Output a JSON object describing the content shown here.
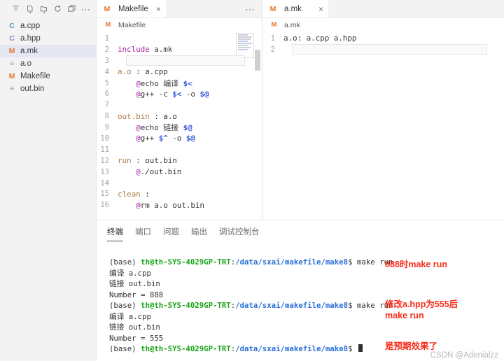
{
  "sidebar": {
    "toolbar": [
      {
        "name": "new-file-icon",
        "label": "New File"
      },
      {
        "name": "new-folder-icon",
        "label": "New Folder"
      },
      {
        "name": "refresh-icon",
        "label": "Refresh Explorer"
      },
      {
        "name": "collapse-folders-icon",
        "label": "Collapse Folders"
      },
      {
        "name": "more-actions-icon",
        "label": "···"
      }
    ],
    "files": [
      {
        "name": "a.cpp",
        "icon": "cpp-file-icon",
        "glyph": "C",
        "selected": false
      },
      {
        "name": "a.hpp",
        "icon": "hpp-file-icon",
        "glyph": "C",
        "selected": false
      },
      {
        "name": "a.mk",
        "icon": "makefile-icon",
        "glyph": "M",
        "selected": true
      },
      {
        "name": "a.o",
        "icon": "binary-file-icon",
        "glyph": "≡",
        "selected": false
      },
      {
        "name": "Makefile",
        "icon": "makefile-icon",
        "glyph": "M",
        "selected": false
      },
      {
        "name": "out.bin",
        "icon": "binary-file-icon",
        "glyph": "≡",
        "selected": false
      }
    ]
  },
  "editors": [
    {
      "tab_label": "Makefile",
      "tab_icon_glyph": "M",
      "tab_close": "×",
      "tab_actions": "···",
      "breadcrumb": "Makefile",
      "lines": [
        {
          "n": "1",
          "tokens": []
        },
        {
          "n": "2",
          "tokens": [
            {
              "t": "include",
              "c": "tk-include"
            },
            {
              "t": " a.mk",
              "c": "tk-plain"
            }
          ]
        },
        {
          "n": "3",
          "tokens": [],
          "cursor": true
        },
        {
          "n": "4",
          "tokens": [
            {
              "t": "a.o",
              "c": "tk-target"
            },
            {
              "t": " : a.cpp",
              "c": "tk-plain"
            }
          ]
        },
        {
          "n": "5",
          "tokens": [
            {
              "t": "    ",
              "c": "tk-plain"
            },
            {
              "t": "@",
              "c": "tk-at"
            },
            {
              "t": "echo 编译 ",
              "c": "tk-plain"
            },
            {
              "t": "$<",
              "c": "tk-var"
            }
          ]
        },
        {
          "n": "6",
          "tokens": [
            {
              "t": "    ",
              "c": "tk-plain"
            },
            {
              "t": "@",
              "c": "tk-at"
            },
            {
              "t": "g++ -c ",
              "c": "tk-plain"
            },
            {
              "t": "$<",
              "c": "tk-var"
            },
            {
              "t": " -o ",
              "c": "tk-plain"
            },
            {
              "t": "$@",
              "c": "tk-var"
            }
          ]
        },
        {
          "n": "7",
          "tokens": []
        },
        {
          "n": "8",
          "tokens": [
            {
              "t": "out.bin",
              "c": "tk-target"
            },
            {
              "t": " : a.o",
              "c": "tk-plain"
            }
          ]
        },
        {
          "n": "9",
          "tokens": [
            {
              "t": "    ",
              "c": "tk-plain"
            },
            {
              "t": "@",
              "c": "tk-at"
            },
            {
              "t": "echo 链接 ",
              "c": "tk-plain"
            },
            {
              "t": "$@",
              "c": "tk-var"
            }
          ]
        },
        {
          "n": "10",
          "tokens": [
            {
              "t": "    ",
              "c": "tk-plain"
            },
            {
              "t": "@",
              "c": "tk-at"
            },
            {
              "t": "g++ ",
              "c": "tk-plain"
            },
            {
              "t": "$^",
              "c": "tk-var"
            },
            {
              "t": " -o ",
              "c": "tk-plain"
            },
            {
              "t": "$@",
              "c": "tk-var"
            }
          ]
        },
        {
          "n": "11",
          "tokens": []
        },
        {
          "n": "12",
          "tokens": [
            {
              "t": "run",
              "c": "tk-target"
            },
            {
              "t": " : out.bin",
              "c": "tk-plain"
            }
          ]
        },
        {
          "n": "13",
          "tokens": [
            {
              "t": "    ",
              "c": "tk-plain"
            },
            {
              "t": "@",
              "c": "tk-at"
            },
            {
              "t": "./out.bin",
              "c": "tk-plain"
            }
          ]
        },
        {
          "n": "14",
          "tokens": []
        },
        {
          "n": "15",
          "tokens": [
            {
              "t": "clean",
              "c": "tk-target"
            },
            {
              "t": " :",
              "c": "tk-plain"
            }
          ]
        },
        {
          "n": "16",
          "tokens": [
            {
              "t": "    ",
              "c": "tk-plain"
            },
            {
              "t": "@",
              "c": "tk-at"
            },
            {
              "t": "rm a.o out.bin",
              "c": "tk-plain"
            }
          ]
        }
      ]
    },
    {
      "tab_label": "a.mk",
      "tab_icon_glyph": "M",
      "tab_close": "×",
      "tab_actions": "",
      "breadcrumb": "a.mk",
      "lines": [
        {
          "n": "1",
          "tokens": [
            {
              "t": "a.o: a.cpp a.hpp",
              "c": "tk-plain"
            }
          ]
        },
        {
          "n": "2",
          "tokens": [],
          "cursor": true
        }
      ]
    }
  ],
  "panel": {
    "tabs": [
      {
        "label": "终端",
        "active": true
      },
      {
        "label": "端口",
        "active": false
      },
      {
        "label": "问题",
        "active": false
      },
      {
        "label": "输出",
        "active": false
      },
      {
        "label": "调试控制台",
        "active": false
      }
    ],
    "terminal_lines": [
      [
        {
          "t": "(base) ",
          "c": "t-plain"
        },
        {
          "t": "th@th-SYS-4029GP-TRT",
          "c": "t-user"
        },
        {
          "t": ":",
          "c": "t-plain"
        },
        {
          "t": "/data/sxai/makefile/make8",
          "c": "t-path"
        },
        {
          "t": "$ make run",
          "c": "t-plain"
        }
      ],
      [
        {
          "t": "编译 a.cpp",
          "c": "t-plain"
        }
      ],
      [
        {
          "t": "链接 out.bin",
          "c": "t-plain"
        }
      ],
      [
        {
          "t": "Number = 888",
          "c": "t-plain"
        }
      ],
      [
        {
          "t": "(base) ",
          "c": "t-plain"
        },
        {
          "t": "th@th-SYS-4029GP-TRT",
          "c": "t-user"
        },
        {
          "t": ":",
          "c": "t-plain"
        },
        {
          "t": "/data/sxai/makefile/make8",
          "c": "t-path"
        },
        {
          "t": "$ make run",
          "c": "t-plain"
        }
      ],
      [
        {
          "t": "编译 a.cpp",
          "c": "t-plain"
        }
      ],
      [
        {
          "t": "链接 out.bin",
          "c": "t-plain"
        }
      ],
      [
        {
          "t": "Number = 555",
          "c": "t-plain"
        }
      ],
      [
        {
          "t": "(base) ",
          "c": "t-plain"
        },
        {
          "t": "th@th-SYS-4029GP-TRT",
          "c": "t-user"
        },
        {
          "t": ":",
          "c": "t-plain"
        },
        {
          "t": "/data/sxai/makefile/make8",
          "c": "t-path"
        },
        {
          "t": "$ ",
          "c": "t-plain"
        },
        {
          "cursor": true
        }
      ]
    ]
  },
  "annotations": {
    "note1": "888时make run",
    "note2": "修改a.hpp为555后\nmake run",
    "note3": "是预期效果了",
    "color": "#fa2c19"
  },
  "watermark": "CSDN @Adenialzz"
}
